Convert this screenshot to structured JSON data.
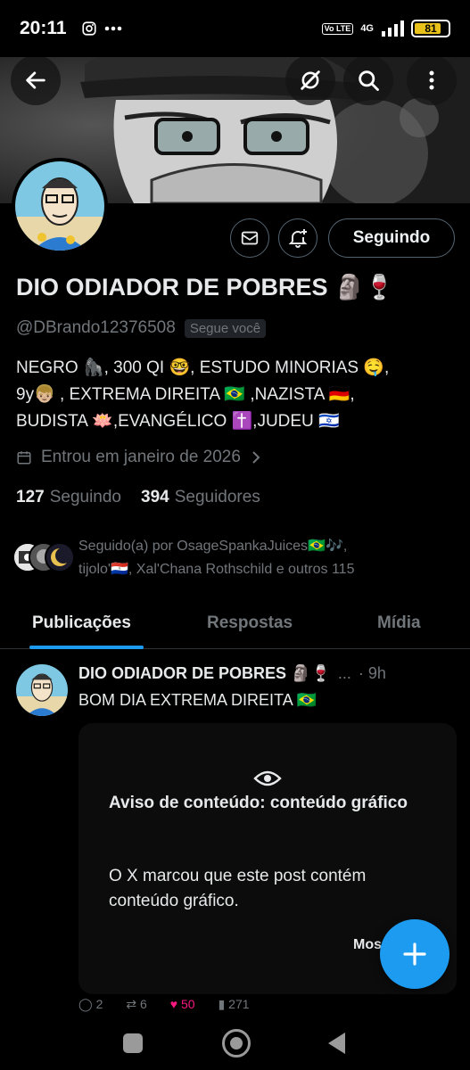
{
  "status_bar": {
    "time": "20:11",
    "network": "4G",
    "volte": "Vo LTE",
    "battery": "81",
    "battery_level": 0.81
  },
  "header": {
    "back_icon": "arrow-left-icon",
    "grok_icon": "grok-icon",
    "search_icon": "search-icon",
    "more_icon": "more-vertical-icon"
  },
  "profile": {
    "display_name": "DIO ODIADOR DE POBRES 🗿🍷",
    "handle": "@DBrando12376508",
    "follows_you": "Segue você",
    "follow_button": "Seguindo",
    "bio_lines": [
      "NEGRO 🦍, 300 QI 🤓, ESTUDO MINORIAS 🤤,",
      "9y👦🏼 , EXTREMA DIREITA 🇧🇷 ,NAZISTA 🇩🇪,",
      "BUDISTA 🪷,EVANGÉLICO ✝️,JUDEU 🇮🇱"
    ],
    "joined": "Entrou em janeiro de 2026",
    "following_count": "127",
    "following_label": "Seguindo",
    "followers_count": "394",
    "followers_label": "Seguidores",
    "followed_by_line1": "Seguido(a) por OsageSpankaJuices🇧🇷🎶,",
    "followed_by_line2": "tijolo'🇵🇾, Xal'Chana Rothschild e outros 115"
  },
  "tabs": [
    {
      "label": "Publicações",
      "active": true
    },
    {
      "label": "Respostas",
      "active": false
    },
    {
      "label": "Mídia",
      "active": false
    }
  ],
  "post": {
    "author": "DIO ODIADOR DE POBRES 🗿🍷",
    "more": "...",
    "time": "· 9h",
    "text": "BOM DIA EXTREMA DIREITA 🇧🇷",
    "warning_title": "Aviso de conteúdo: conteúdo gráfico",
    "warning_body": "O X marcou que este post contém conteúdo gráfico.",
    "warning_more": "Mos",
    "actions": {
      "replies": "2",
      "reposts": "6",
      "likes": "50",
      "views": "271"
    }
  },
  "colors": {
    "accent": "#1d9bf0",
    "like": "#f91880",
    "muted": "#71767b",
    "background": "#000000"
  }
}
